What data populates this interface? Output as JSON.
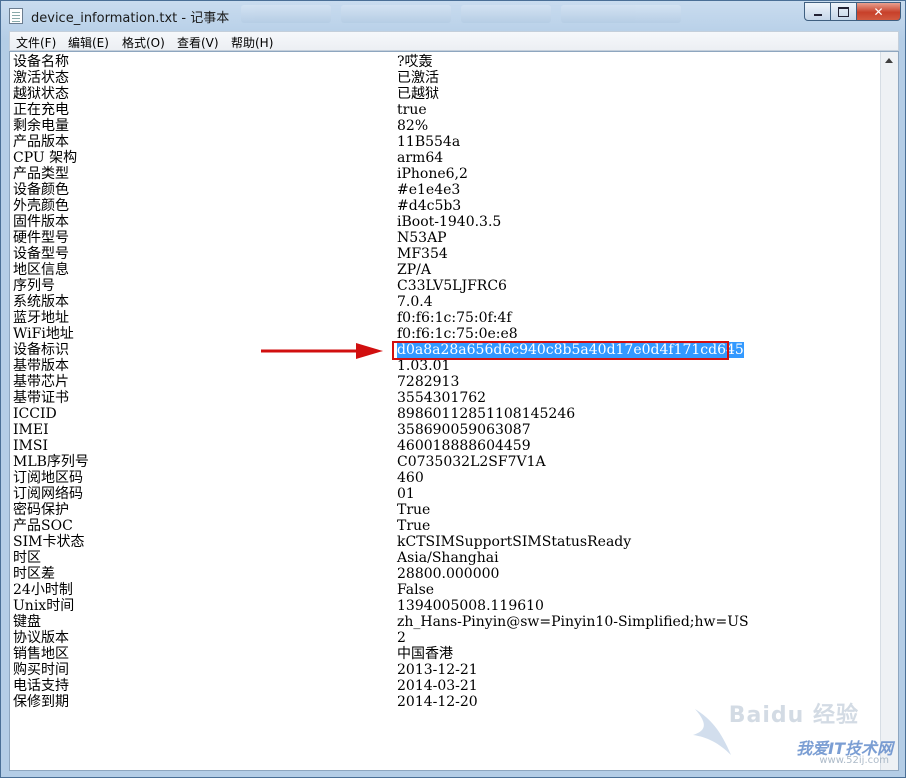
{
  "window": {
    "title": "device_information.txt - 记事本"
  },
  "menu": {
    "items": [
      "文件(F)",
      "编辑(E)",
      "格式(O)",
      "查看(V)",
      "帮助(H)"
    ]
  },
  "document": {
    "rows": [
      {
        "key": "设备名称",
        "value": "?哎轰"
      },
      {
        "key": "激活状态",
        "value": "已激活"
      },
      {
        "key": "越狱状态",
        "value": "已越狱"
      },
      {
        "key": "正在充电",
        "value": "true"
      },
      {
        "key": "剩余电量",
        "value": "82%"
      },
      {
        "key": "产品版本",
        "value": "11B554a"
      },
      {
        "key": "CPU 架构",
        "value": "arm64"
      },
      {
        "key": "产品类型",
        "value": "iPhone6,2"
      },
      {
        "key": "设备颜色",
        "value": "#e1e4e3"
      },
      {
        "key": "外壳颜色",
        "value": "#d4c5b3"
      },
      {
        "key": "固件版本",
        "value": "iBoot-1940.3.5"
      },
      {
        "key": "硬件型号",
        "value": "N53AP"
      },
      {
        "key": "设备型号",
        "value": "MF354"
      },
      {
        "key": "地区信息",
        "value": "ZP/A"
      },
      {
        "key": "序列号",
        "value": "C33LV5LJFRC6"
      },
      {
        "key": "系统版本",
        "value": "7.0.4"
      },
      {
        "key": "蓝牙地址",
        "value": "f0:f6:1c:75:0f:4f"
      },
      {
        "key": "WiFi地址",
        "value": "f0:f6:1c:75:0e:e8"
      },
      {
        "key": "设备标识",
        "value": "d0a8a28a656d6c940c8b5a40d17e0d4f171cd645",
        "selected": true
      },
      {
        "key": "基带版本",
        "value": "1.03.01"
      },
      {
        "key": "基带芯片",
        "value": "7282913"
      },
      {
        "key": "基带证书",
        "value": "3554301762"
      },
      {
        "key": "ICCID",
        "value": "89860112851108145246"
      },
      {
        "key": "IMEI",
        "value": "358690059063087"
      },
      {
        "key": "IMSI",
        "value": "460018888604459"
      },
      {
        "key": "MLB序列号",
        "value": "C0735032L2SF7V1A"
      },
      {
        "key": "订阅地区码",
        "value": "460"
      },
      {
        "key": "订阅网络码",
        "value": "01"
      },
      {
        "key": "密码保护",
        "value": "True"
      },
      {
        "key": "产品SOC",
        "value": "True"
      },
      {
        "key": "SIM卡状态",
        "value": "kCTSIMSupportSIMStatusReady"
      },
      {
        "key": "时区",
        "value": "Asia/Shanghai"
      },
      {
        "key": "时区差",
        "value": "28800.000000"
      },
      {
        "key": "24小时制",
        "value": "False"
      },
      {
        "key": "Unix时间",
        "value": "1394005008.119610"
      },
      {
        "key": "键盘",
        "value": "zh_Hans-Pinyin@sw=Pinyin10-Simplified;hw=US"
      },
      {
        "key": "协议版本",
        "value": "2"
      },
      {
        "key": "销售地区",
        "value": "中国香港"
      },
      {
        "key": "购买时间",
        "value": "2013-12-21"
      },
      {
        "key": "电话支持",
        "value": "2014-03-21"
      },
      {
        "key": "保修到期",
        "value": "2014-12-20"
      }
    ]
  },
  "annotation": {
    "highlight_color": "#d10f0f"
  },
  "watermark": {
    "line1": "Baidu 经验",
    "line2": "我爱IT技术网",
    "line3": "www.52ij.com"
  }
}
